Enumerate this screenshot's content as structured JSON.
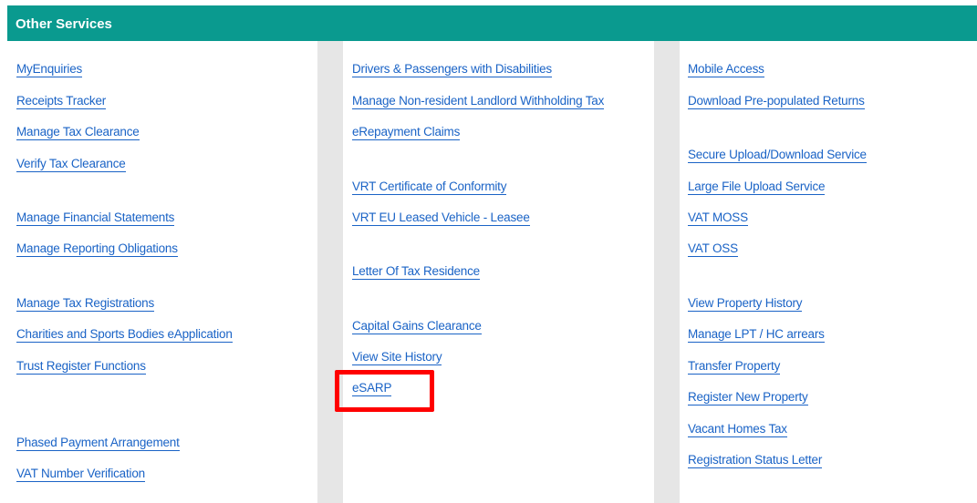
{
  "header": {
    "title": "Other Services"
  },
  "columns": [
    {
      "links": [
        {
          "label": "MyEnquiries"
        },
        {
          "label": "Receipts Tracker"
        },
        {
          "label": "Manage Tax Clearance"
        },
        {
          "label": "Verify Tax Clearance"
        },
        {
          "label": "Manage Financial Statements"
        },
        {
          "label": "Manage Reporting Obligations"
        },
        {
          "label": "Manage Tax Registrations"
        },
        {
          "label": "Charities and Sports Bodies eApplication"
        },
        {
          "label": "Trust Register Functions"
        },
        {
          "label": "Phased Payment Arrangement"
        },
        {
          "label": "VAT Number Verification"
        }
      ]
    },
    {
      "links": [
        {
          "label": "Drivers & Passengers with Disabilities"
        },
        {
          "label": "Manage Non-resident Landlord Withholding Tax"
        },
        {
          "label": "eRepayment Claims"
        },
        {
          "label": "VRT Certificate of Conformity"
        },
        {
          "label": "VRT EU Leased Vehicle - Leasee"
        },
        {
          "label": "Letter Of Tax Residence"
        },
        {
          "label": "Capital Gains Clearance"
        },
        {
          "label": "View Site History"
        },
        {
          "label": "eSARP"
        }
      ]
    },
    {
      "links": [
        {
          "label": "Mobile Access"
        },
        {
          "label": "Download Pre-populated Returns"
        },
        {
          "label": "Secure Upload/Download Service"
        },
        {
          "label": "Large File Upload Service"
        },
        {
          "label": "VAT MOSS"
        },
        {
          "label": "VAT OSS"
        },
        {
          "label": "View Property History"
        },
        {
          "label": "Manage LPT / HC arrears"
        },
        {
          "label": "Transfer Property"
        },
        {
          "label": "Register New Property"
        },
        {
          "label": "Vacant Homes Tax"
        },
        {
          "label": "Registration Status Letter"
        }
      ]
    }
  ],
  "colors": {
    "header_bg": "#0a9a8f",
    "link": "#1a63c6",
    "highlight": "#ff0000"
  }
}
